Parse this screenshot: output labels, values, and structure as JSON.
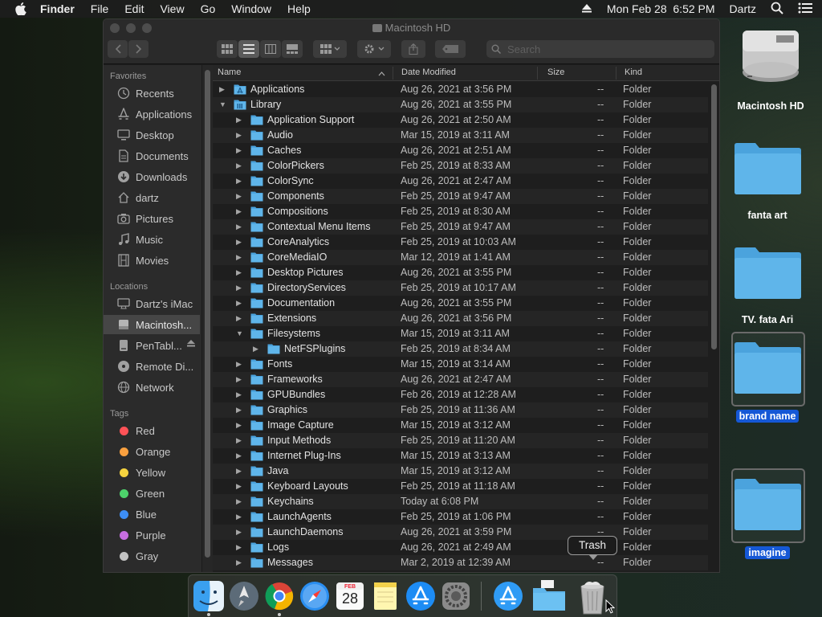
{
  "menubar": {
    "app": "Finder",
    "items": [
      "File",
      "Edit",
      "View",
      "Go",
      "Window",
      "Help"
    ],
    "datetime": "Mon Feb 28  6:52 PM",
    "user": "Dartz"
  },
  "window": {
    "title": "Macintosh HD",
    "search_placeholder": "Search"
  },
  "sidebar": {
    "favorites_header": "Favorites",
    "favorites": [
      {
        "label": "Recents",
        "icon": "clock-icon"
      },
      {
        "label": "Applications",
        "icon": "applications-icon"
      },
      {
        "label": "Desktop",
        "icon": "desktop-icon"
      },
      {
        "label": "Documents",
        "icon": "document-icon"
      },
      {
        "label": "Downloads",
        "icon": "download-icon"
      },
      {
        "label": "dartz",
        "icon": "home-icon"
      },
      {
        "label": "Pictures",
        "icon": "camera-icon"
      },
      {
        "label": "Music",
        "icon": "music-icon"
      },
      {
        "label": "Movies",
        "icon": "film-icon"
      }
    ],
    "locations_header": "Locations",
    "locations": [
      {
        "label": "Dartz's iMac",
        "icon": "imac-icon"
      },
      {
        "label": "Macintosh...",
        "icon": "hard-drive-icon",
        "selected": true
      },
      {
        "label": "PenTabl...",
        "icon": "external-drive-icon"
      },
      {
        "label": "Remote Di...",
        "icon": "disc-icon"
      },
      {
        "label": "Network",
        "icon": "globe-icon"
      }
    ],
    "tags_header": "Tags",
    "tags": [
      {
        "label": "Red",
        "color": "#ff5257"
      },
      {
        "label": "Orange",
        "color": "#f9a03f"
      },
      {
        "label": "Yellow",
        "color": "#f5d33f"
      },
      {
        "label": "Green",
        "color": "#4dd36b"
      },
      {
        "label": "Blue",
        "color": "#3d8ef5"
      },
      {
        "label": "Purple",
        "color": "#c76ee0"
      },
      {
        "label": "Gray",
        "color": "#c2c2c2"
      }
    ]
  },
  "columns": {
    "name": "Name",
    "date": "Date Modified",
    "size": "Size",
    "kind": "Kind"
  },
  "rows": [
    {
      "name": "Applications",
      "date": "Aug 26, 2021 at 3:56 PM",
      "size": "--",
      "kind": "Folder",
      "level": 0,
      "expanded": false,
      "special": "applications"
    },
    {
      "name": "Library",
      "date": "Aug 26, 2021 at 3:55 PM",
      "size": "--",
      "kind": "Folder",
      "level": 0,
      "expanded": true,
      "special": "library"
    },
    {
      "name": "Application Support",
      "date": "Aug 26, 2021 at 2:50 AM",
      "size": "--",
      "kind": "Folder",
      "level": 1,
      "expanded": false
    },
    {
      "name": "Audio",
      "date": "Mar 15, 2019 at 3:11 AM",
      "size": "--",
      "kind": "Folder",
      "level": 1,
      "expanded": false
    },
    {
      "name": "Caches",
      "date": "Aug 26, 2021 at 2:51 AM",
      "size": "--",
      "kind": "Folder",
      "level": 1,
      "expanded": false
    },
    {
      "name": "ColorPickers",
      "date": "Feb 25, 2019 at 8:33 AM",
      "size": "--",
      "kind": "Folder",
      "level": 1,
      "expanded": false
    },
    {
      "name": "ColorSync",
      "date": "Aug 26, 2021 at 2:47 AM",
      "size": "--",
      "kind": "Folder",
      "level": 1,
      "expanded": false
    },
    {
      "name": "Components",
      "date": "Feb 25, 2019 at 9:47 AM",
      "size": "--",
      "kind": "Folder",
      "level": 1,
      "expanded": false
    },
    {
      "name": "Compositions",
      "date": "Feb 25, 2019 at 8:30 AM",
      "size": "--",
      "kind": "Folder",
      "level": 1,
      "expanded": false
    },
    {
      "name": "Contextual Menu Items",
      "date": "Feb 25, 2019 at 9:47 AM",
      "size": "--",
      "kind": "Folder",
      "level": 1,
      "expanded": false
    },
    {
      "name": "CoreAnalytics",
      "date": "Feb 25, 2019 at 10:03 AM",
      "size": "--",
      "kind": "Folder",
      "level": 1,
      "expanded": false
    },
    {
      "name": "CoreMediaIO",
      "date": "Mar 12, 2019 at 1:41 AM",
      "size": "--",
      "kind": "Folder",
      "level": 1,
      "expanded": false
    },
    {
      "name": "Desktop Pictures",
      "date": "Aug 26, 2021 at 3:55 PM",
      "size": "--",
      "kind": "Folder",
      "level": 1,
      "expanded": false
    },
    {
      "name": "DirectoryServices",
      "date": "Feb 25, 2019 at 10:17 AM",
      "size": "--",
      "kind": "Folder",
      "level": 1,
      "expanded": false
    },
    {
      "name": "Documentation",
      "date": "Aug 26, 2021 at 3:55 PM",
      "size": "--",
      "kind": "Folder",
      "level": 1,
      "expanded": false
    },
    {
      "name": "Extensions",
      "date": "Aug 26, 2021 at 3:56 PM",
      "size": "--",
      "kind": "Folder",
      "level": 1,
      "expanded": false
    },
    {
      "name": "Filesystems",
      "date": "Mar 15, 2019 at 3:11 AM",
      "size": "--",
      "kind": "Folder",
      "level": 1,
      "expanded": true
    },
    {
      "name": "NetFSPlugins",
      "date": "Feb 25, 2019 at 8:34 AM",
      "size": "--",
      "kind": "Folder",
      "level": 2,
      "expanded": false
    },
    {
      "name": "Fonts",
      "date": "Mar 15, 2019 at 3:14 AM",
      "size": "--",
      "kind": "Folder",
      "level": 1,
      "expanded": false
    },
    {
      "name": "Frameworks",
      "date": "Aug 26, 2021 at 2:47 AM",
      "size": "--",
      "kind": "Folder",
      "level": 1,
      "expanded": false
    },
    {
      "name": "GPUBundles",
      "date": "Feb 26, 2019 at 12:28 AM",
      "size": "--",
      "kind": "Folder",
      "level": 1,
      "expanded": false
    },
    {
      "name": "Graphics",
      "date": "Feb 25, 2019 at 11:36 AM",
      "size": "--",
      "kind": "Folder",
      "level": 1,
      "expanded": false
    },
    {
      "name": "Image Capture",
      "date": "Mar 15, 2019 at 3:12 AM",
      "size": "--",
      "kind": "Folder",
      "level": 1,
      "expanded": false
    },
    {
      "name": "Input Methods",
      "date": "Feb 25, 2019 at 11:20 AM",
      "size": "--",
      "kind": "Folder",
      "level": 1,
      "expanded": false
    },
    {
      "name": "Internet Plug-Ins",
      "date": "Mar 15, 2019 at 3:13 AM",
      "size": "--",
      "kind": "Folder",
      "level": 1,
      "expanded": false
    },
    {
      "name": "Java",
      "date": "Mar 15, 2019 at 3:12 AM",
      "size": "--",
      "kind": "Folder",
      "level": 1,
      "expanded": false
    },
    {
      "name": "Keyboard Layouts",
      "date": "Feb 25, 2019 at 11:18 AM",
      "size": "--",
      "kind": "Folder",
      "level": 1,
      "expanded": false
    },
    {
      "name": "Keychains",
      "date": "Today at 6:08 PM",
      "size": "--",
      "kind": "Folder",
      "level": 1,
      "expanded": false
    },
    {
      "name": "LaunchAgents",
      "date": "Feb 25, 2019 at 1:06 PM",
      "size": "--",
      "kind": "Folder",
      "level": 1,
      "expanded": false
    },
    {
      "name": "LaunchDaemons",
      "date": "Aug 26, 2021 at 3:59 PM",
      "size": "--",
      "kind": "Folder",
      "level": 1,
      "expanded": false
    },
    {
      "name": "Logs",
      "date": "Aug 26, 2021 at 2:49 AM",
      "size": "--",
      "kind": "Folder",
      "level": 1,
      "expanded": false
    },
    {
      "name": "Messages",
      "date": "Mar 2, 2019 at 12:39 AM",
      "size": "--",
      "kind": "Folder",
      "level": 1,
      "expanded": false
    }
  ],
  "desktop": {
    "hd_label": "Macintosh HD",
    "folders": [
      {
        "label": "fanta art",
        "selected": false
      },
      {
        "label": "TV. fata Ari",
        "selected": false
      },
      {
        "label": "brand name",
        "selected": true
      },
      {
        "label": "imagine",
        "selected": true
      }
    ]
  },
  "dock": {
    "apps": [
      "finder-icon",
      "launchpad-icon",
      "chrome-icon",
      "safari-icon",
      "calendar-icon",
      "notes-icon",
      "app-store-icon",
      "system-preferences-icon",
      "app-store-icon",
      "downloads-folder-icon",
      "trash-icon"
    ],
    "calendar_month": "FEB",
    "calendar_day": "28",
    "tooltip": "Trash"
  },
  "colors": {
    "folder_blue": "#5fb5ea",
    "selection_blue": "#1558d6",
    "window_bg": "#1e1e1e",
    "sidebar_bg": "#2b2b2b"
  }
}
